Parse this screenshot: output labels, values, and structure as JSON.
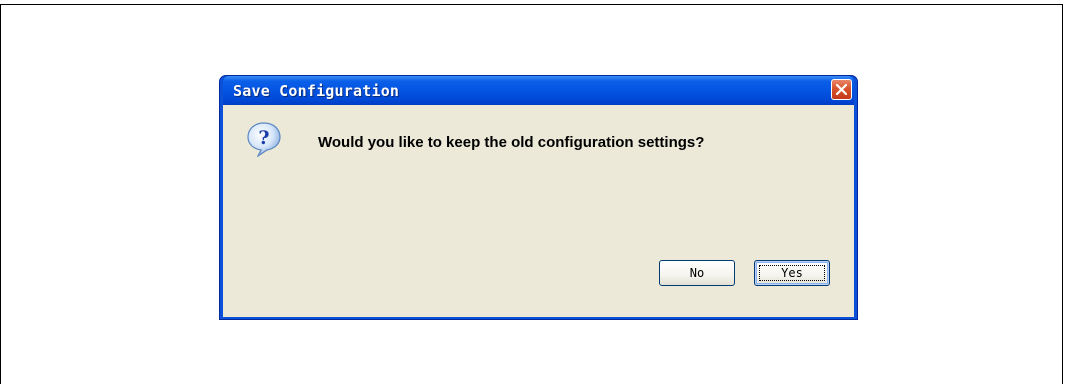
{
  "dialog": {
    "title": "Save Configuration",
    "message": "Would you like to keep the old configuration settings?",
    "icon": "question-icon",
    "close_icon": "close-icon",
    "buttons": {
      "no_label": "No",
      "yes_label": "Yes",
      "default": "Yes"
    }
  },
  "colors": {
    "titlebar": "#0454e2",
    "client_background": "#ece9d8",
    "close_button": "#d9542b"
  }
}
